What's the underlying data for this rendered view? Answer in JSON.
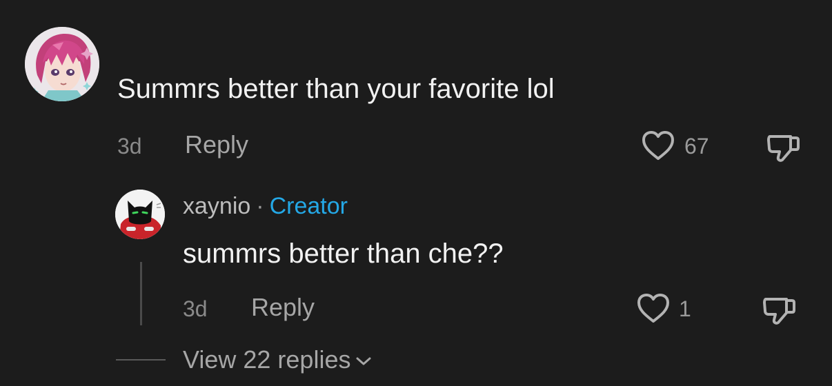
{
  "comment": {
    "text": "Summrs better than your favorite lol",
    "time": "3d",
    "reply_label": "Reply",
    "likes": "67"
  },
  "reply": {
    "author": "xaynio",
    "separator": "·",
    "badge": "Creator",
    "text": "summrs better than che??",
    "time": "3d",
    "reply_label": "Reply",
    "likes": "1"
  },
  "view_replies": {
    "label": "View 22 replies"
  },
  "colors": {
    "background": "#1c1c1c",
    "creator_badge": "#24a8e6"
  },
  "icons": {
    "like": "heart-icon",
    "dislike": "thumbs-down-icon",
    "expand": "chevron-down-icon"
  }
}
